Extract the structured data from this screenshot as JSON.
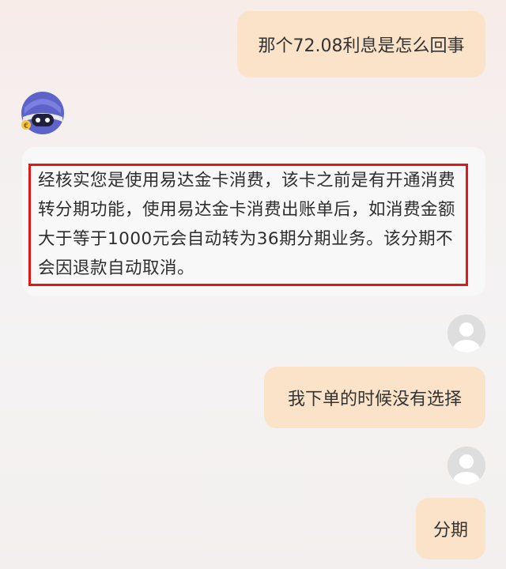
{
  "messages": [
    {
      "role": "user",
      "text": "那个72.08利息是怎么回事"
    },
    {
      "role": "bot",
      "text": "经核实您是使用易达金卡消费，该卡之前是有开通消费转分期功能，使用易达金卡消费出账单后，如消费金额大于等于1000元会自动转为36期分期业务。该分期不会因退款自动取消。"
    },
    {
      "role": "user",
      "text": "我下单的时候没有选择"
    },
    {
      "role": "user",
      "text": "分期"
    }
  ],
  "colors": {
    "user_bubble": "#fbe3c9",
    "bot_bubble": "#f8f8f8",
    "highlight_border": "#e01818"
  },
  "icons": {
    "bot_avatar": "robot-avatar-icon",
    "user_avatar": "default-user-avatar-icon"
  }
}
